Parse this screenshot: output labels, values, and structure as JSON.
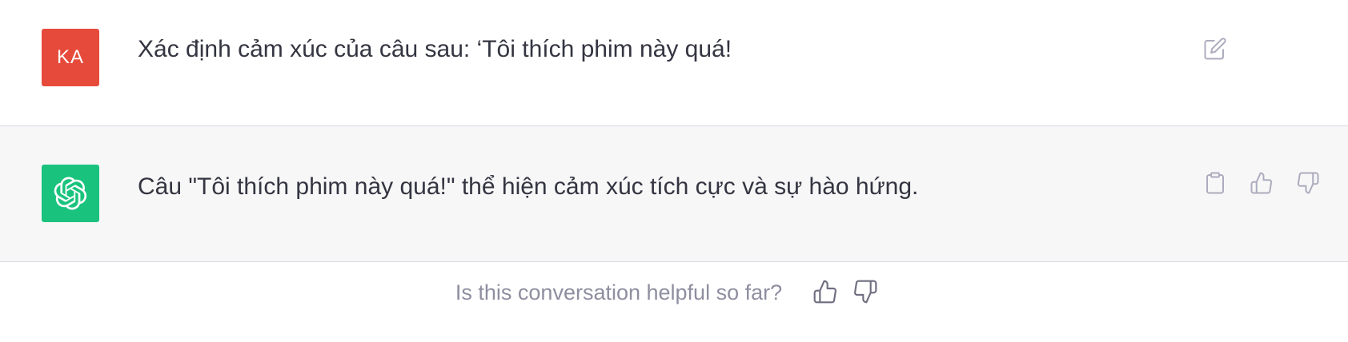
{
  "user_message": {
    "avatar_initials": "KA",
    "avatar_color": "#e64a3b",
    "text": "Xác định cảm xúc của câu sau: ‘Tôi thích phim này quá!"
  },
  "assistant_message": {
    "avatar_color": "#19c37d",
    "avatar_icon": "openai-logo-icon",
    "text": "Câu \"Tôi thích phim này quá!\" thể hiện cảm xúc tích cực và sự hào hứng."
  },
  "feedback": {
    "prompt": "Is this conversation helpful so far?"
  },
  "icons": {
    "edit": "edit-icon",
    "copy": "clipboard-icon",
    "thumbs_up": "thumbs-up-icon",
    "thumbs_down": "thumbs-down-icon"
  }
}
